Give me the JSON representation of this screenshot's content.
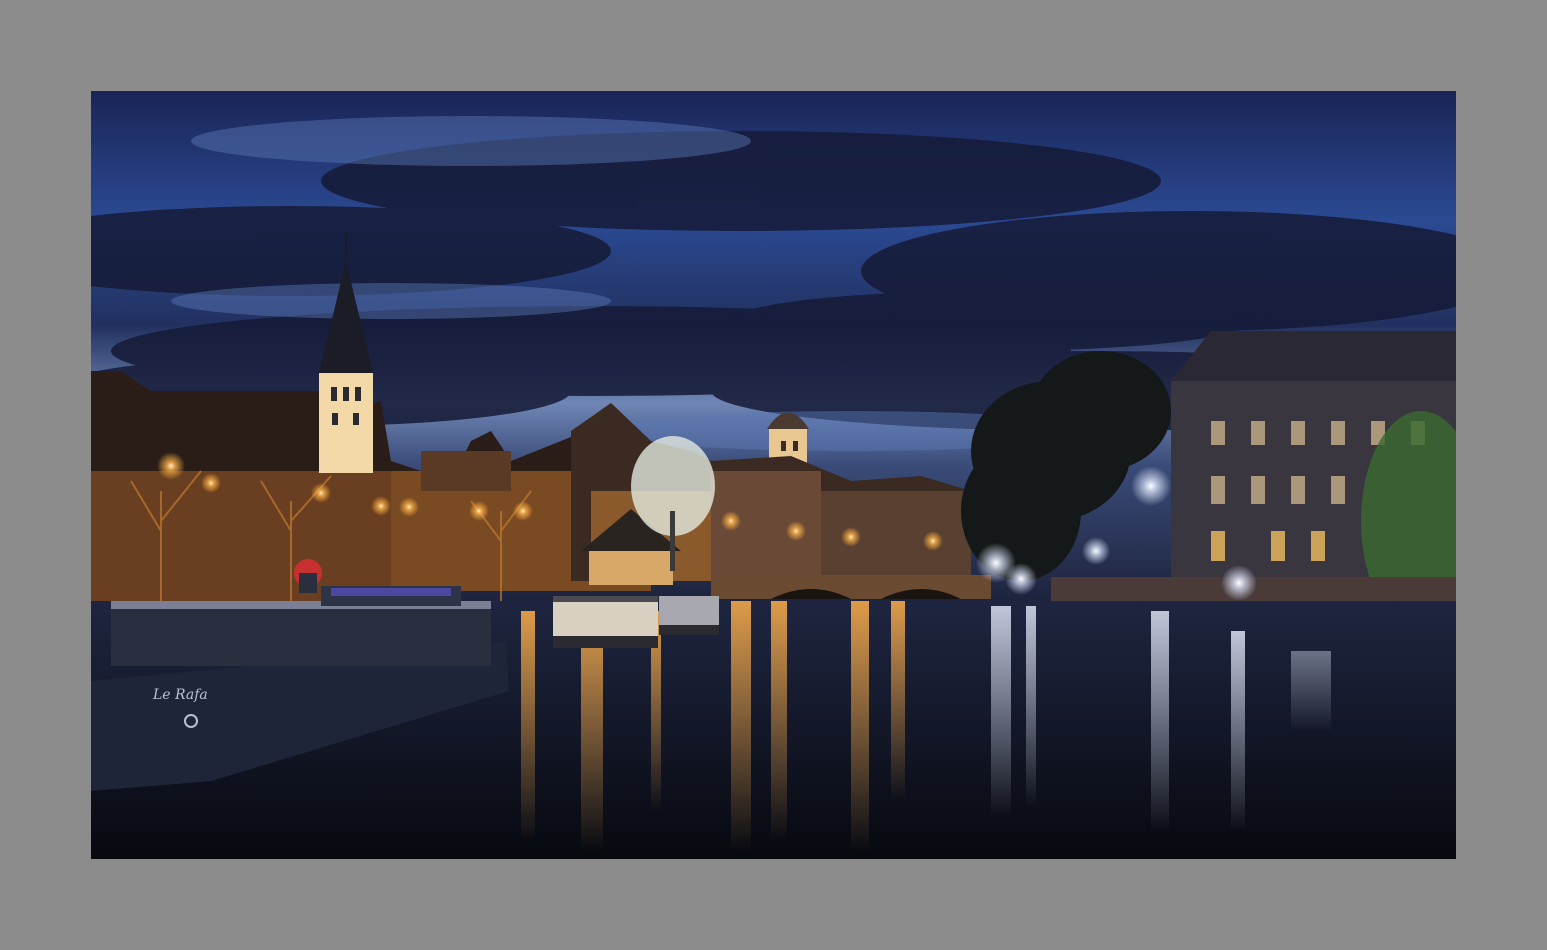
{
  "frame": {
    "background_color": "#8c8c8c"
  },
  "photo": {
    "subject": "night-river-townscape",
    "boat_name": "Le Rafa",
    "colors": {
      "sky_top": "#1d2c5e",
      "sky_mid": "#2e4a92",
      "sky_horizon": "#8fa6c8",
      "cloud": "#1c1f3a",
      "lamp_glow": "#ffb347",
      "water": "#0e1424",
      "tower_light": "#f5d8a0"
    }
  }
}
